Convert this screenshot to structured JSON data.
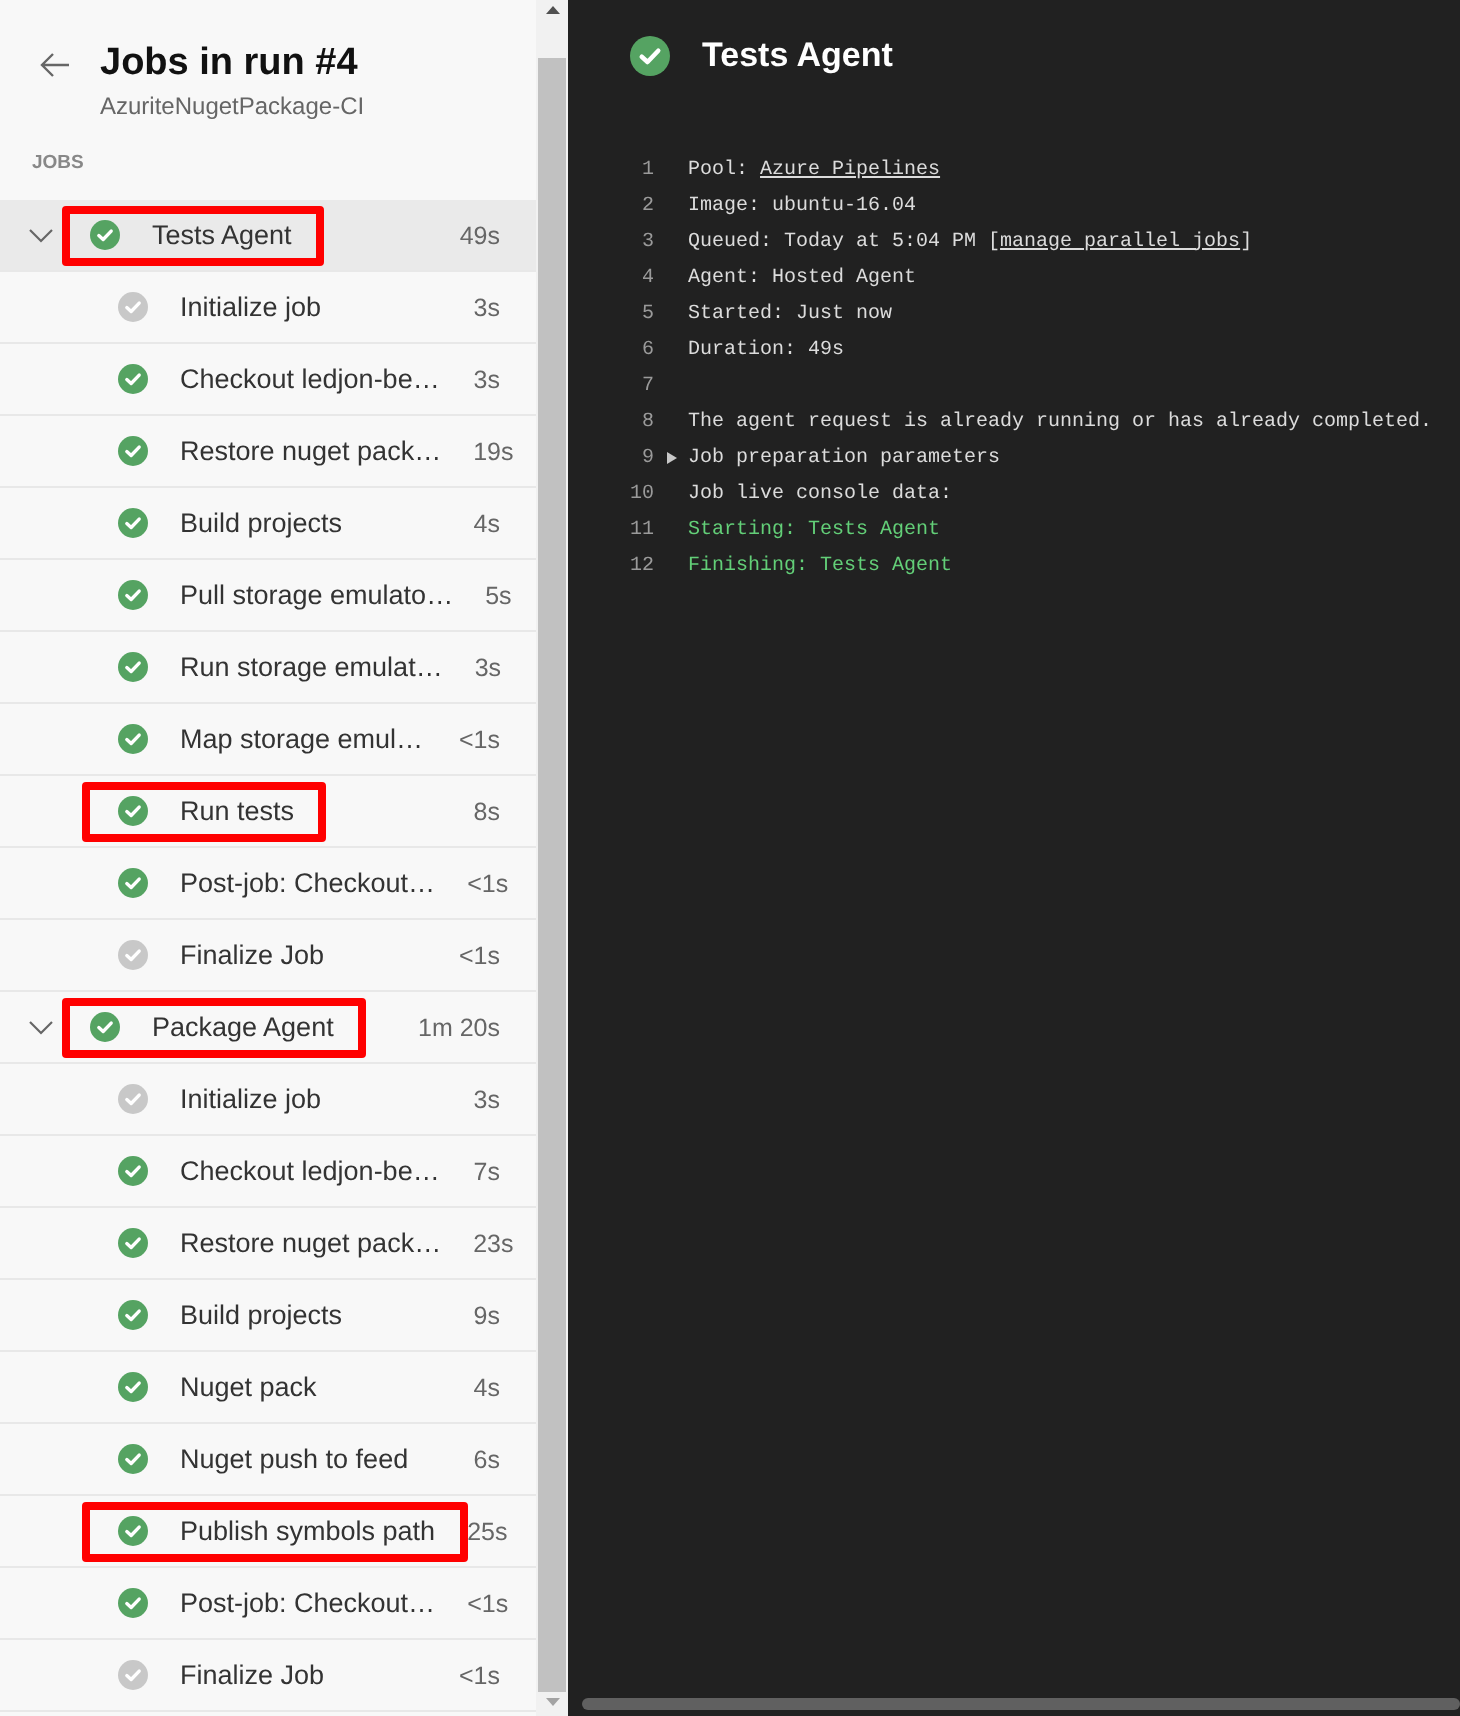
{
  "header": {
    "title": "Jobs in run #4",
    "subtitle": "AzuriteNugetPackage-CI"
  },
  "section_label": "JOBS",
  "jobs": [
    {
      "name": "Tests Agent",
      "duration": "49s",
      "greyed": false,
      "expanded": true,
      "selected": true,
      "highlighted": true,
      "steps": [
        {
          "name": "Initialize job",
          "duration": "3s",
          "greyed": true,
          "selected": false,
          "highlighted": false
        },
        {
          "name": "Checkout ledjon-be…",
          "duration": "3s",
          "greyed": false,
          "selected": false,
          "highlighted": false
        },
        {
          "name": "Restore nuget pack…",
          "duration": "19s",
          "greyed": false,
          "selected": false,
          "highlighted": false
        },
        {
          "name": "Build projects",
          "duration": "4s",
          "greyed": false,
          "selected": false,
          "highlighted": false
        },
        {
          "name": "Pull storage emulato…",
          "duration": "5s",
          "greyed": false,
          "selected": false,
          "highlighted": false
        },
        {
          "name": "Run storage emulat…",
          "duration": "3s",
          "greyed": false,
          "selected": false,
          "highlighted": false
        },
        {
          "name": "Map storage emul…",
          "duration": "<1s",
          "greyed": false,
          "selected": false,
          "highlighted": false
        },
        {
          "name": "Run tests",
          "duration": "8s",
          "greyed": false,
          "selected": false,
          "highlighted": true
        },
        {
          "name": "Post-job: Checkout…",
          "duration": "<1s",
          "greyed": false,
          "selected": false,
          "highlighted": false
        },
        {
          "name": "Finalize Job",
          "duration": "<1s",
          "greyed": true,
          "selected": false,
          "highlighted": false
        }
      ]
    },
    {
      "name": "Package Agent",
      "duration": "1m 20s",
      "greyed": false,
      "expanded": true,
      "selected": false,
      "highlighted": true,
      "steps": [
        {
          "name": "Initialize job",
          "duration": "3s",
          "greyed": true,
          "selected": false,
          "highlighted": false
        },
        {
          "name": "Checkout ledjon-be…",
          "duration": "7s",
          "greyed": false,
          "selected": false,
          "highlighted": false
        },
        {
          "name": "Restore nuget pack…",
          "duration": "23s",
          "greyed": false,
          "selected": false,
          "highlighted": false
        },
        {
          "name": "Build projects",
          "duration": "9s",
          "greyed": false,
          "selected": false,
          "highlighted": false
        },
        {
          "name": "Nuget pack",
          "duration": "4s",
          "greyed": false,
          "selected": false,
          "highlighted": false
        },
        {
          "name": "Nuget push to feed",
          "duration": "6s",
          "greyed": false,
          "selected": false,
          "highlighted": false
        },
        {
          "name": "Publish symbols path",
          "duration": "25s",
          "greyed": false,
          "selected": false,
          "highlighted": true
        },
        {
          "name": "Post-job: Checkout…",
          "duration": "<1s",
          "greyed": false,
          "selected": false,
          "highlighted": false
        },
        {
          "name": "Finalize Job",
          "duration": "<1s",
          "greyed": true,
          "selected": false,
          "highlighted": false
        }
      ]
    }
  ],
  "log": {
    "title": "Tests Agent",
    "greyed": false,
    "lines": [
      {
        "number": "1",
        "segments": [
          {
            "kind": "plain",
            "text": "Pool: "
          },
          {
            "kind": "link",
            "text": "Azure Pipelines"
          }
        ]
      },
      {
        "number": "2",
        "segments": [
          {
            "kind": "plain",
            "text": "Image: ubuntu-16.04"
          }
        ]
      },
      {
        "number": "3",
        "segments": [
          {
            "kind": "plain",
            "text": "Queued: Today at 5:04 PM ["
          },
          {
            "kind": "link",
            "text": "manage parallel jobs"
          },
          {
            "kind": "plain",
            "text": "]"
          }
        ]
      },
      {
        "number": "4",
        "segments": [
          {
            "kind": "plain",
            "text": "Agent: Hosted Agent"
          }
        ]
      },
      {
        "number": "5",
        "segments": [
          {
            "kind": "plain",
            "text": "Started: Just now"
          }
        ]
      },
      {
        "number": "6",
        "segments": [
          {
            "kind": "plain",
            "text": "Duration: 49s"
          }
        ]
      },
      {
        "number": "7"
      },
      {
        "number": "8",
        "segments": [
          {
            "kind": "plain",
            "text": "The agent request is already running or has already completed."
          }
        ]
      },
      {
        "number": "9",
        "expanded": false,
        "segments": [
          {
            "kind": "plain",
            "text": "Job preparation parameters"
          }
        ]
      },
      {
        "number": "10",
        "segments": [
          {
            "kind": "plain",
            "text": "Job live console data:"
          }
        ]
      },
      {
        "number": "11",
        "segments": [
          {
            "kind": "success",
            "text": "Starting: Tests Agent"
          }
        ]
      },
      {
        "number": "12",
        "segments": [
          {
            "kind": "success",
            "text": "Finishing: Tests Agent"
          }
        ]
      }
    ]
  }
}
